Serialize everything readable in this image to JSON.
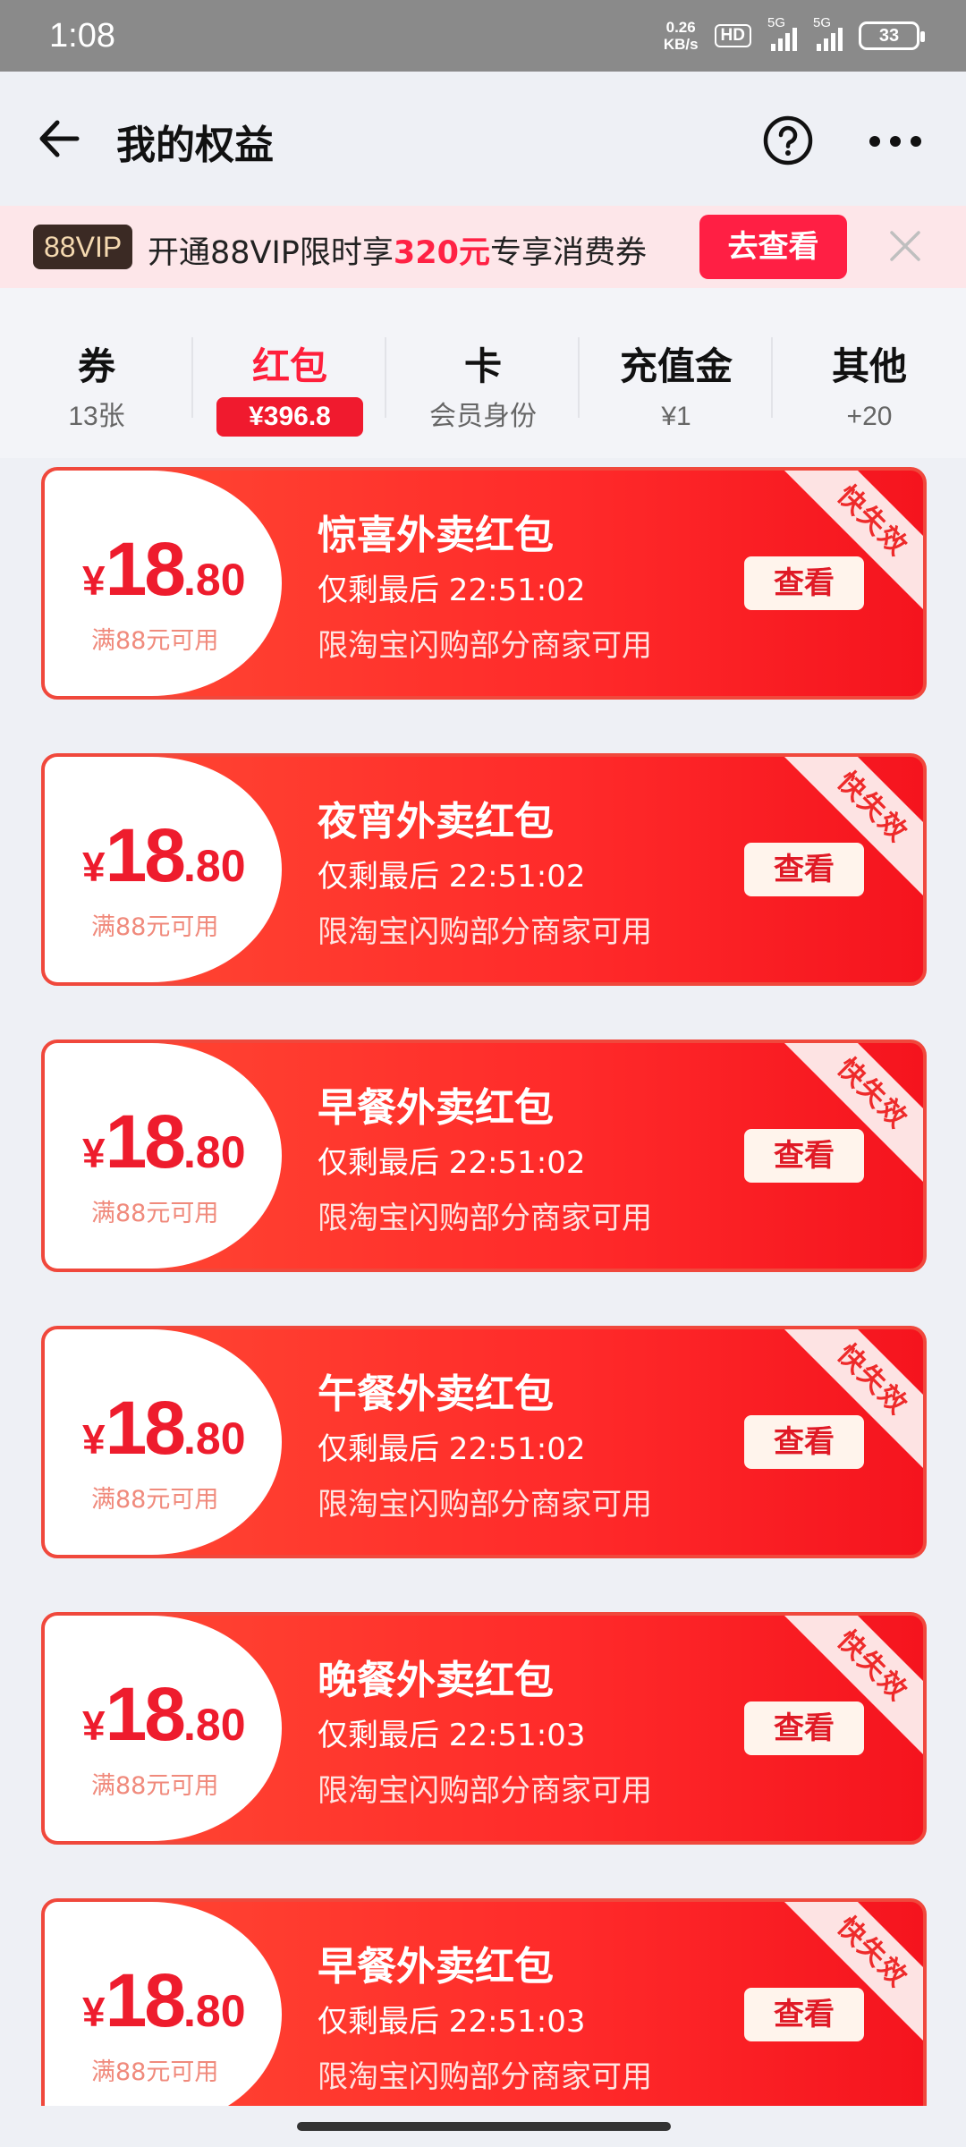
{
  "status_bar": {
    "time": "1:08",
    "net_speed_value": "0.26",
    "net_speed_unit": "KB/s",
    "hd_label": "HD",
    "sim1_label": "5G",
    "sim2_label": "5G",
    "battery": "33"
  },
  "header": {
    "title": "我的权益"
  },
  "vip_banner": {
    "badge": "88VIP",
    "text_prefix": "开通88VIP限时享",
    "highlight": "320元",
    "text_suffix": "专享消费券",
    "button_label": "去查看"
  },
  "tabs": [
    {
      "label": "券",
      "sub": "13张",
      "active": false
    },
    {
      "label": "红包",
      "sub": "¥396.8",
      "active": true
    },
    {
      "label": "卡",
      "sub": "会员身份",
      "active": false
    },
    {
      "label": "充值金",
      "sub": "¥1",
      "active": false
    },
    {
      "label": "其他",
      "sub": "+20",
      "active": false
    }
  ],
  "coupons": [
    {
      "currency": "¥",
      "amount_int": "18",
      "amount_dec": ".80",
      "min_spend": "满88元可用",
      "title": "惊喜外卖红包",
      "expiry": "仅剩最后 22:51:02",
      "desc": "限淘宝闪购部分商家可用",
      "button": "查看",
      "ribbon": "快失效"
    },
    {
      "currency": "¥",
      "amount_int": "18",
      "amount_dec": ".80",
      "min_spend": "满88元可用",
      "title": "夜宵外卖红包",
      "expiry": "仅剩最后 22:51:02",
      "desc": "限淘宝闪购部分商家可用",
      "button": "查看",
      "ribbon": "快失效"
    },
    {
      "currency": "¥",
      "amount_int": "18",
      "amount_dec": ".80",
      "min_spend": "满88元可用",
      "title": "早餐外卖红包",
      "expiry": "仅剩最后 22:51:02",
      "desc": "限淘宝闪购部分商家可用",
      "button": "查看",
      "ribbon": "快失效"
    },
    {
      "currency": "¥",
      "amount_int": "18",
      "amount_dec": ".80",
      "min_spend": "满88元可用",
      "title": "午餐外卖红包",
      "expiry": "仅剩最后 22:51:02",
      "desc": "限淘宝闪购部分商家可用",
      "button": "查看",
      "ribbon": "快失效"
    },
    {
      "currency": "¥",
      "amount_int": "18",
      "amount_dec": ".80",
      "min_spend": "满88元可用",
      "title": "晚餐外卖红包",
      "expiry": "仅剩最后 22:51:03",
      "desc": "限淘宝闪购部分商家可用",
      "button": "查看",
      "ribbon": "快失效"
    },
    {
      "currency": "¥",
      "amount_int": "18",
      "amount_dec": ".80",
      "min_spend": "满88元可用",
      "title": "早餐外卖红包",
      "expiry": "仅剩最后 22:51:03",
      "desc": "限淘宝闪购部分商家可用",
      "button": "查看",
      "ribbon": "快失效"
    }
  ],
  "colors": {
    "accent_red": "#ff1f44",
    "coupon_red": "#ff2a2a",
    "page_bg": "#eef0f5"
  }
}
